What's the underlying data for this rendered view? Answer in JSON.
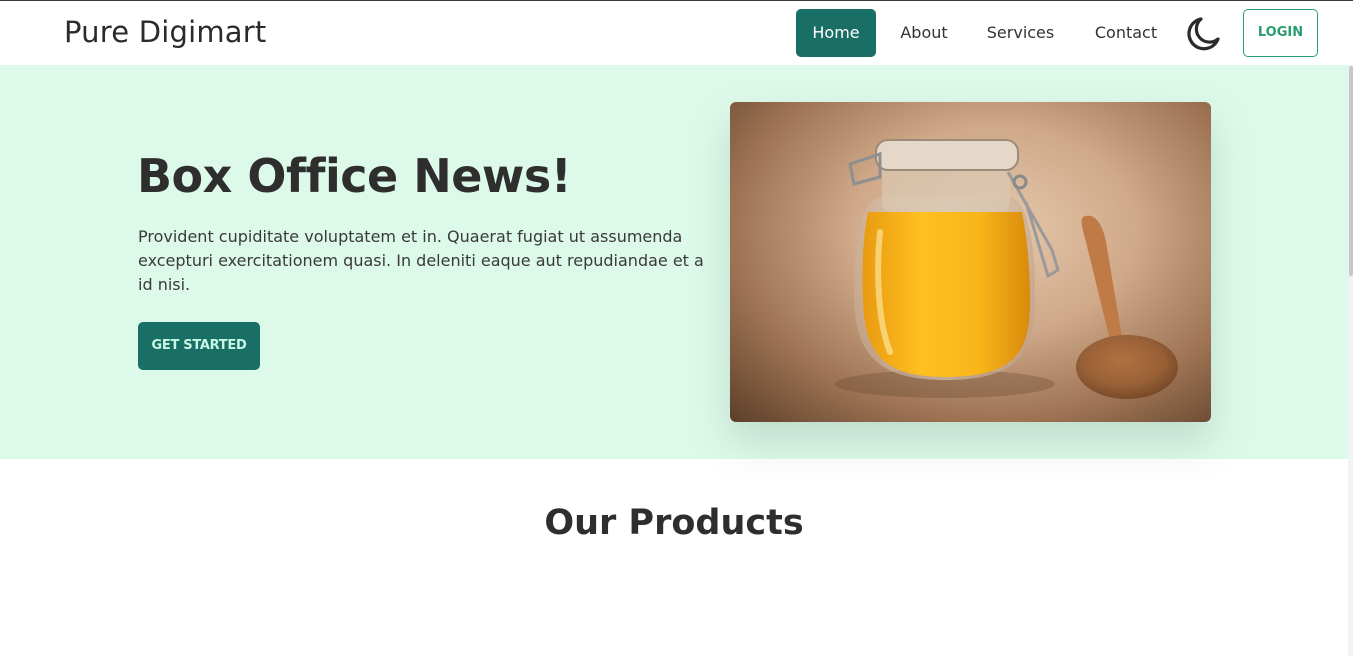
{
  "navbar": {
    "brand": "Pure Digimart",
    "items": [
      {
        "label": "Home",
        "active": true
      },
      {
        "label": "About",
        "active": false
      },
      {
        "label": "Services",
        "active": false
      },
      {
        "label": "Contact",
        "active": false
      }
    ],
    "theme_toggle_icon": "moon-icon",
    "login_label": "LOGIN"
  },
  "hero": {
    "title": "Box Office News!",
    "text": "Provident cupiditate voluptatem et in. Quaerat fugiat ut assumenda excepturi exercitationem quasi. In deleniti eaque aut repudiandae et a id nisi.",
    "cta_label": "GET STARTED",
    "image": "jar-of-ghee-with-wooden-spoon"
  },
  "products": {
    "title": "Our Products"
  },
  "colors": {
    "primary": "#196e66",
    "accent": "#2a9d6f",
    "hero_bg": "#ddf9ea"
  }
}
